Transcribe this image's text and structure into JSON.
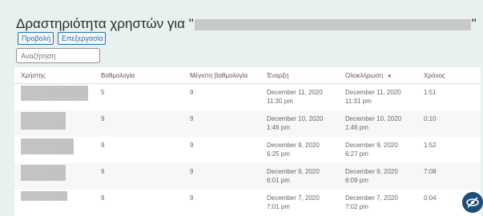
{
  "header": {
    "title_prefix": "Δραστηριότητα χρηστών για \"",
    "title_suffix": "\""
  },
  "toolbar": {
    "view_label": "Προβολή",
    "edit_label": "Επεξεργασία"
  },
  "search": {
    "placeholder": "Αναζήτηση",
    "value": ""
  },
  "table": {
    "columns": [
      "Χρήστης",
      "Βαθμολογία",
      "Μέγιστη βαθμολογία",
      "Έναρξη",
      "Ολοκλήρωση",
      "Χρόνος"
    ],
    "rows": [
      {
        "score": "5",
        "max": "9",
        "start": "December 11, 2020 11:30 pm",
        "end": "December 11, 2020 11:31 pm",
        "time": "1:51"
      },
      {
        "score": "9",
        "max": "9",
        "start": "December 10, 2020 1:46 pm",
        "end": "December 10, 2020 1:46 pm",
        "time": "0:10"
      },
      {
        "score": "9",
        "max": "9",
        "start": "December 9, 2020 6:25 pm",
        "end": "December 9, 2020 6:27 pm",
        "time": "1:52"
      },
      {
        "score": "9",
        "max": "9",
        "start": "December 9, 2020 6:01 pm",
        "end": "December 9, 2020 6:09 pm",
        "time": "7:08"
      },
      {
        "score": "9",
        "max": "9",
        "start": "December 7, 2020 7:01 pm",
        "end": "December 7, 2020 7:02 pm",
        "time": "0:04"
      }
    ]
  },
  "colors": {
    "accent": "#2271b1",
    "badge": "#1f4e79"
  },
  "icons": {
    "sort": "triangle-down",
    "badge": "hidden-eye-icon"
  }
}
